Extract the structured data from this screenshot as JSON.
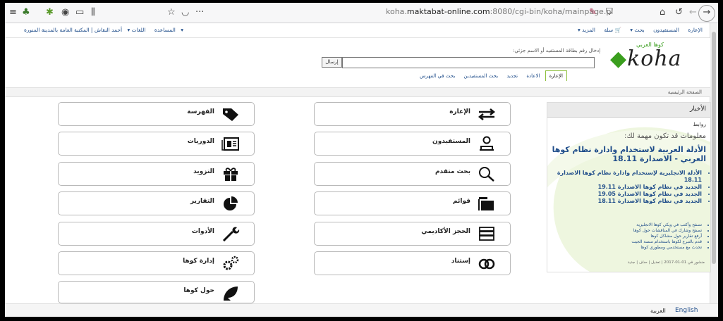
{
  "browser": {
    "url_prefix": "koha.",
    "url_domain": "maktabat-online.com",
    "url_rest": ":8080/cgi-bin/koha/mainpage.pl",
    "toolbar_icons": [
      "menu-icon",
      "tree-icon",
      "plugin-icon",
      "eye-icon",
      "reader-icon",
      "library-icon",
      "star-icon",
      "pocket-icon",
      "more-icon",
      "tracking-icon",
      "shield-icon",
      "home-icon",
      "reload-icon",
      "forward-icon",
      "back-icon"
    ]
  },
  "topnav": {
    "user_info": "أحمد النقاش | المكتبة العامة بالمدينة المنورة ▾",
    "languages": "اللغات ▾",
    "help": "المساعدة",
    "right_items": [
      "الإعارة",
      "المستفيدون",
      "بحث ▾",
      "🛒 سلة",
      "المزيد ▾"
    ]
  },
  "header": {
    "logo_text": "koha",
    "logo_arabic": "كوها العربي",
    "search_label": "إدخال رقم بطاقة المستفيد أو الاسم جزئي:",
    "search_value": "",
    "send_button": "إرسال",
    "tabs": [
      "الإعارة",
      "الاعادة",
      "تجديد",
      "بحث المستفيدين",
      "بحث في الفهرس"
    ]
  },
  "breadcrumb": "الصفحة الرئيسية",
  "modules_left": [
    {
      "label": "الإعارة",
      "icon": "circulation-icon"
    },
    {
      "label": "المستفيدون",
      "icon": "patrons-icon"
    },
    {
      "label": "بحث متقدم",
      "icon": "advanced-search-icon"
    },
    {
      "label": "قوائم",
      "icon": "lists-icon"
    },
    {
      "label": "الحجز الأكاديمي",
      "icon": "course-reserves-icon"
    },
    {
      "label": "إستناد",
      "icon": "authorities-icon"
    }
  ],
  "modules_right": [
    {
      "label": "الفهرسة",
      "icon": "cataloging-icon"
    },
    {
      "label": "الدوريات",
      "icon": "serials-icon"
    },
    {
      "label": "التزويد",
      "icon": "acquisitions-icon"
    },
    {
      "label": "التقارير",
      "icon": "reports-icon"
    },
    {
      "label": "الأدوات",
      "icon": "tools-icon"
    },
    {
      "label": "إدارة كوها",
      "icon": "koha-admin-icon"
    },
    {
      "label": "حول كوها",
      "icon": "about-koha-icon"
    }
  ],
  "news": {
    "header": "الأخبار",
    "links_label": "روابط",
    "subtitle": "معلومات قد تكون مهمة لك:",
    "title": "الأدلة العربية لاستخدام وادارة نظام كوها العربي - الاصدارة 18.11",
    "items": [
      "الأدلة الانجليزية لإستخدام وادارة نظام كوها الاصدارة 18.11",
      "الجديد في نظام كوها الاصدارة 19.11",
      "الجديد في نظام كوها الاصدارة 19.05",
      "الجديد في نظام كوها الاصدارة 18.11"
    ],
    "small_items": [
      "تصفح وأكتب في ويكي كوها الانجليزية",
      "تصفح وشارك في المناقشات حول كوها",
      "أرفع تقارير حول مشاكل كوها",
      "قدم بالتبرع لكوها باستخدام منصة الجيت",
      "تحدث مع مستخدمي ومطوري كوها"
    ],
    "posted": "منشور في 01-01-2017 | تعديل | حذف | جديد"
  },
  "footer": {
    "english": "English",
    "arabic": "العربية"
  },
  "colors": {
    "accent": "#8fc03e",
    "link": "#1f4d8a"
  }
}
